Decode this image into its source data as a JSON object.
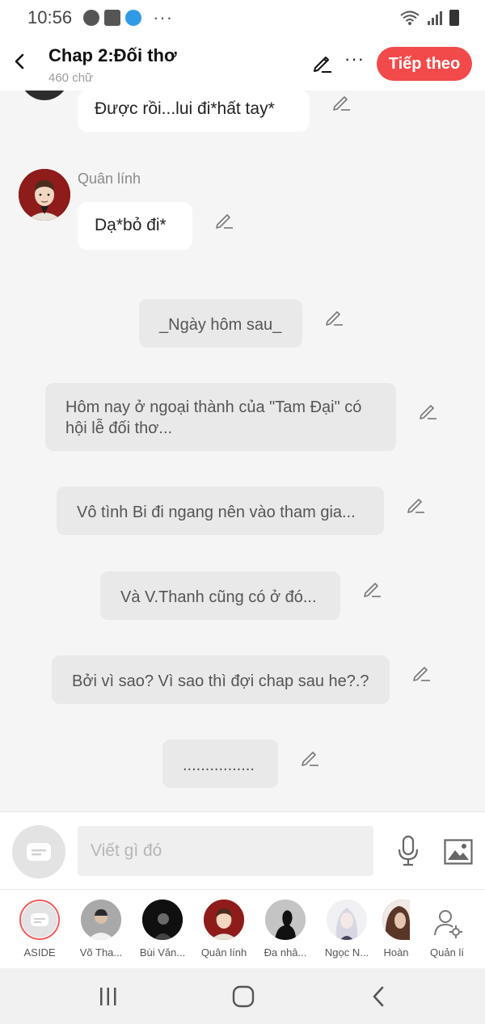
{
  "status": {
    "time": "10:56"
  },
  "header": {
    "title": "Chap 2:Đối thơ",
    "subtitle": "460 chữ",
    "next_label": "Tiếp theo"
  },
  "messages": [
    {
      "type": "dialogue",
      "text": "Được rồi...lui đi*hất tay*"
    },
    {
      "type": "dialogue",
      "speaker": "Quân lính",
      "text": "Dạ*bỏ đi*"
    },
    {
      "type": "narration",
      "text": "_Ngày hôm sau_"
    },
    {
      "type": "narration",
      "text": "Hôm nay ở ngoại thành của \"Tam Đại\" có hội lễ đối thơ..."
    },
    {
      "type": "narration",
      "text": "Vô tình Bi đi ngang nên vào tham gia..."
    },
    {
      "type": "narration",
      "text": "Và V.Thanh cũng có ở đó..."
    },
    {
      "type": "narration",
      "text": "Bởi vì sao? Vì sao thì đợi chap sau he?.?"
    },
    {
      "type": "narration",
      "text": "................"
    }
  ],
  "composer": {
    "placeholder": "Viết gì đó"
  },
  "characters": [
    {
      "name": "ASIDE",
      "selected": true
    },
    {
      "name": "Võ Tha..."
    },
    {
      "name": "Bùi Văn..."
    },
    {
      "name": "Quân lính"
    },
    {
      "name": "Đa nhâ..."
    },
    {
      "name": "Ngọc N..."
    },
    {
      "name": "Hoàn"
    },
    {
      "name": "Quản lí"
    }
  ],
  "colors": {
    "accent": "#f24a4a",
    "bubble_grey": "#e9e9e9",
    "background": "#f5f5f5"
  }
}
